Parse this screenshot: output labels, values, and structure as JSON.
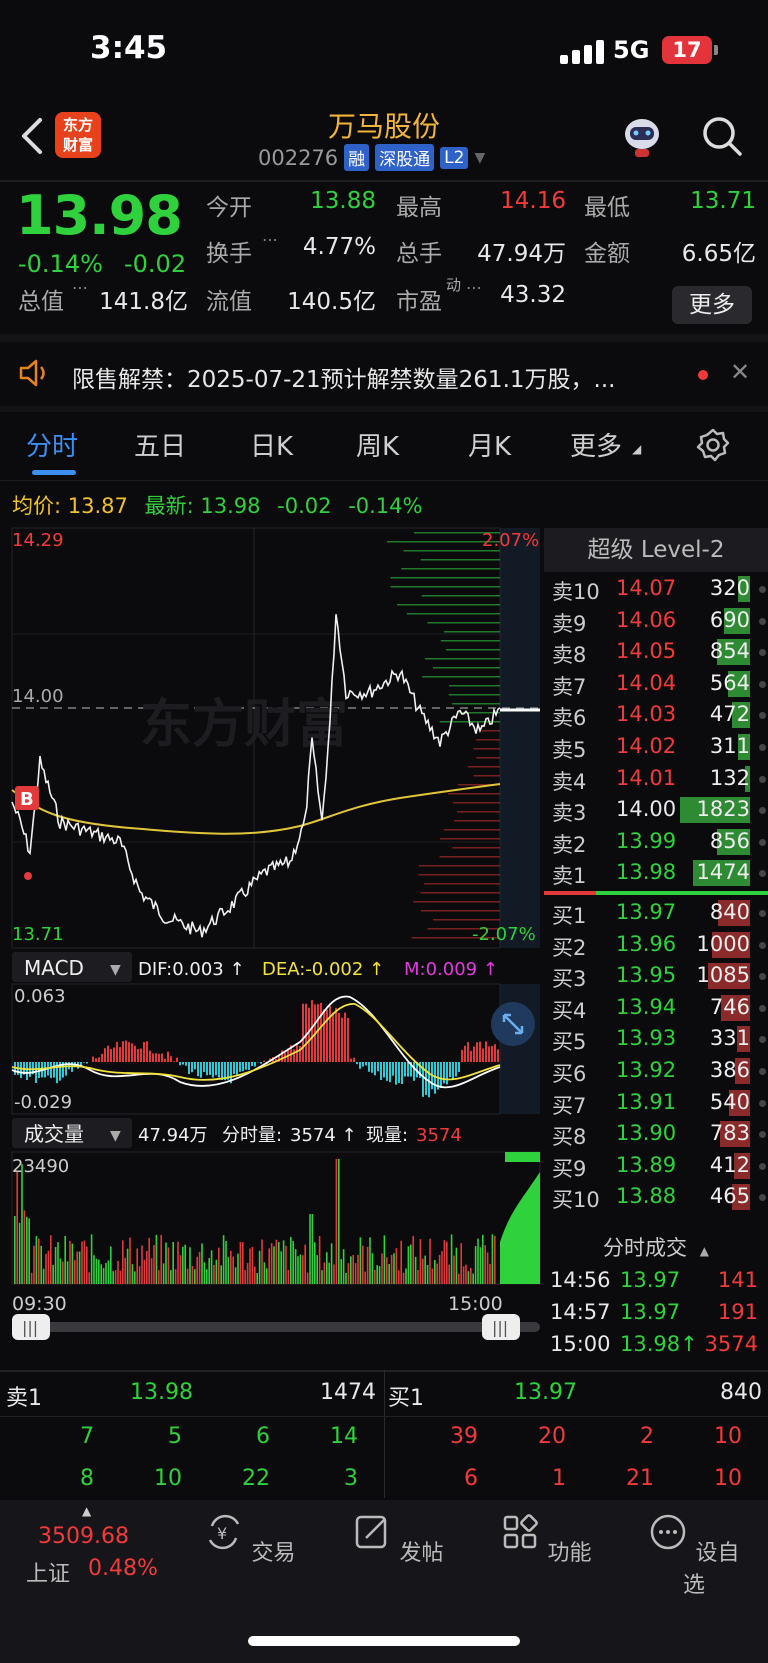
{
  "status_bar": {
    "time": "3:45",
    "network": "5G",
    "battery": "17"
  },
  "header": {
    "logo_text": "东方财富",
    "title": "万马股份",
    "code": "002276",
    "tags": [
      "融",
      "深股通",
      "L2"
    ]
  },
  "quote": {
    "price": "13.98",
    "change_pct": "-0.14%",
    "change": "-0.02",
    "fields": [
      {
        "label": "今开",
        "value": "13.88",
        "color": "green"
      },
      {
        "label": "最高",
        "value": "14.16",
        "color": "red"
      },
      {
        "label": "最低",
        "value": "13.71",
        "color": "green"
      },
      {
        "label": "换手",
        "value": "4.77%",
        "color": "white"
      },
      {
        "label": "总手",
        "value": "47.94万",
        "color": "white"
      },
      {
        "label": "金额",
        "value": "6.65亿",
        "color": "white"
      },
      {
        "label": "总值",
        "value": "141.8亿",
        "color": "white"
      },
      {
        "label": "流值",
        "value": "140.5亿",
        "color": "white"
      },
      {
        "label": "市盈",
        "value": "43.32",
        "color": "white"
      }
    ],
    "pe_superscript": "动",
    "more_button": "更多"
  },
  "notice": {
    "text": "限售解禁：2025-07-21预计解禁数量261.1万股，..."
  },
  "tabs": [
    "分时",
    "五日",
    "日K",
    "周K",
    "月K",
    "更多"
  ],
  "legend": {
    "avg_label": "均价:",
    "avg_value": "13.87",
    "latest_label": "最新:",
    "latest_value": "13.98",
    "change": "-0.02",
    "change_pct": "-0.14%"
  },
  "chart_data": {
    "type": "line",
    "price_axis": {
      "top": "14.29",
      "mid": "14.00",
      "bottom": "13.71",
      "top_pct": "2.07%",
      "bottom_pct": "-2.07%"
    },
    "macd": {
      "label": "MACD",
      "dif": "DIF:0.003 ↑",
      "dea": "DEA:-0.002 ↑",
      "m": "M:0.009 ↑",
      "top": "0.063",
      "bottom": "-0.029"
    },
    "volume": {
      "label": "成交量",
      "total": "47.94万",
      "minute_label": "分时量:",
      "minute_value": "3574 ↑",
      "current_label": "现量:",
      "current_value": "3574",
      "top": "23490"
    },
    "time_axis": {
      "start": "09:30",
      "end": "15:00"
    },
    "b_marker": "B",
    "watermark": "东方财富"
  },
  "level2": {
    "title": "超级 Level-2",
    "asks": [
      {
        "label": "卖10",
        "price": "14.07",
        "vol": "320",
        "color": "red"
      },
      {
        "label": "卖9",
        "price": "14.06",
        "vol": "690",
        "color": "red"
      },
      {
        "label": "卖8",
        "price": "14.05",
        "vol": "854",
        "color": "red"
      },
      {
        "label": "卖7",
        "price": "14.04",
        "vol": "564",
        "color": "red"
      },
      {
        "label": "卖6",
        "price": "14.03",
        "vol": "472",
        "color": "red"
      },
      {
        "label": "卖5",
        "price": "14.02",
        "vol": "311",
        "color": "red"
      },
      {
        "label": "卖4",
        "price": "14.01",
        "vol": "132",
        "color": "red"
      },
      {
        "label": "卖3",
        "price": "14.00",
        "vol": "1823",
        "color": "white"
      },
      {
        "label": "卖2",
        "price": "13.99",
        "vol": "856",
        "color": "green"
      },
      {
        "label": "卖1",
        "price": "13.98",
        "vol": "1474",
        "color": "green"
      }
    ],
    "bids": [
      {
        "label": "买1",
        "price": "13.97",
        "vol": "840",
        "color": "green"
      },
      {
        "label": "买2",
        "price": "13.96",
        "vol": "1000",
        "color": "green"
      },
      {
        "label": "买3",
        "price": "13.95",
        "vol": "1085",
        "color": "green"
      },
      {
        "label": "买4",
        "price": "13.94",
        "vol": "746",
        "color": "green"
      },
      {
        "label": "买5",
        "price": "13.93",
        "vol": "331",
        "color": "green"
      },
      {
        "label": "买6",
        "price": "13.92",
        "vol": "386",
        "color": "green"
      },
      {
        "label": "买7",
        "price": "13.91",
        "vol": "540",
        "color": "green"
      },
      {
        "label": "买8",
        "price": "13.90",
        "vol": "783",
        "color": "green"
      },
      {
        "label": "买9",
        "price": "13.89",
        "vol": "412",
        "color": "green"
      },
      {
        "label": "买10",
        "price": "13.88",
        "vol": "465",
        "color": "green"
      }
    ]
  },
  "trades": {
    "title": "分时成交",
    "rows": [
      {
        "time": "14:56",
        "price": "13.97",
        "vol": "141"
      },
      {
        "time": "14:57",
        "price": "13.97",
        "vol": "191"
      },
      {
        "time": "15:00",
        "price": "13.98↑",
        "vol": "3574"
      }
    ]
  },
  "bottom_book": {
    "sell_label": "卖1",
    "sell_price": "13.98",
    "sell_vol": "1474",
    "buy_label": "买1",
    "buy_price": "13.97",
    "buy_vol": "840",
    "sell_queue_row1": [
      "7",
      "5",
      "6",
      "14"
    ],
    "sell_queue_row2": [
      "8",
      "10",
      "22",
      "3"
    ],
    "buy_queue_row1": [
      "39",
      "20",
      "2",
      "10"
    ],
    "buy_queue_row2": [
      "6",
      "1",
      "21",
      "10"
    ]
  },
  "nav": {
    "index_value": "3509.68",
    "index_name": "上证",
    "index_change": "0.48%",
    "items": [
      "交易",
      "发帖",
      "功能",
      "设自选"
    ]
  }
}
